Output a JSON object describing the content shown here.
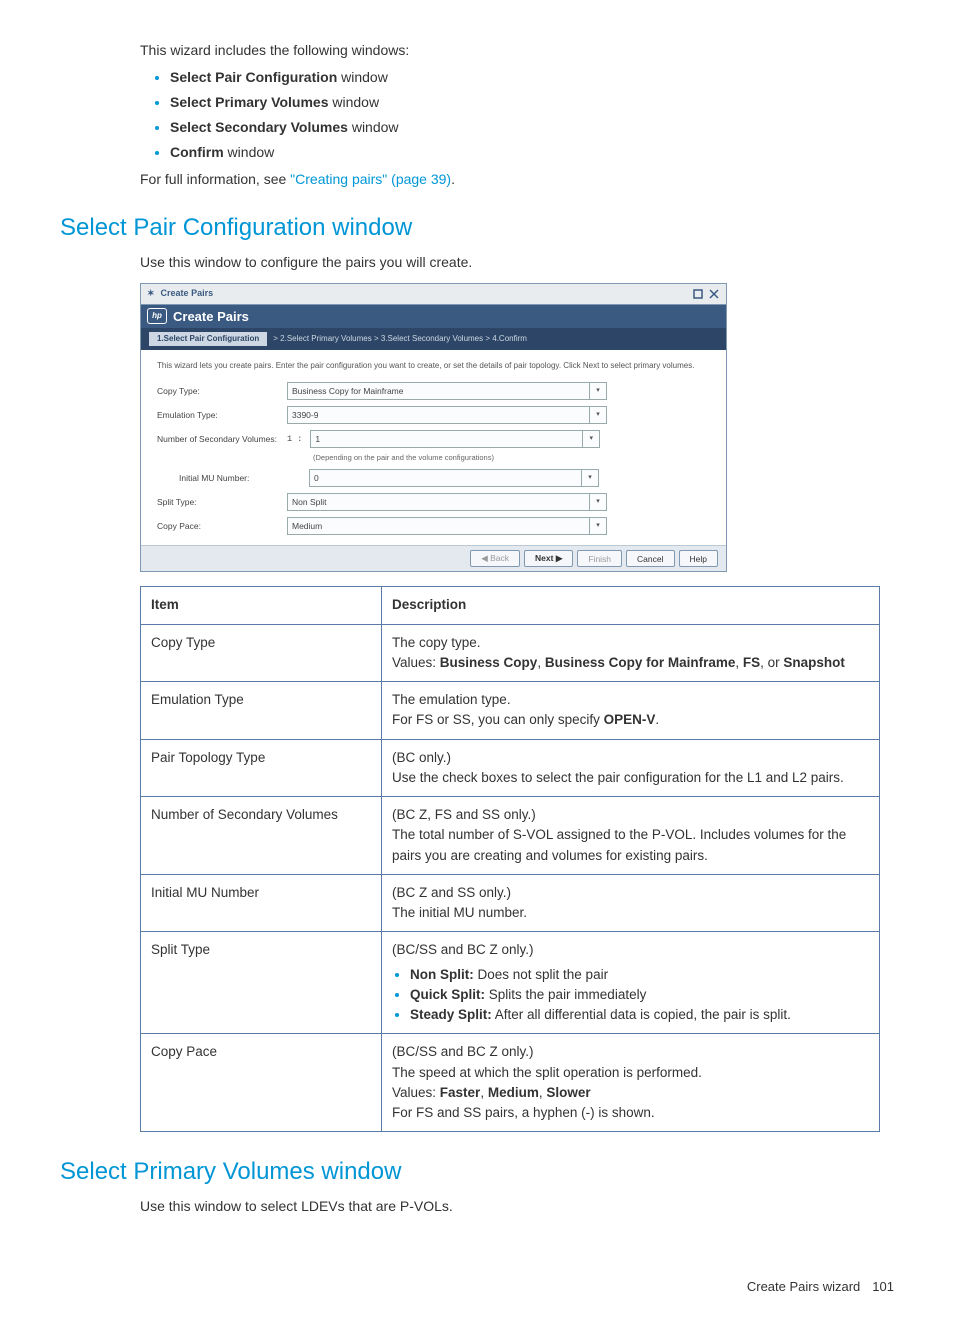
{
  "intro": {
    "line1": "This wizard includes the following windows:",
    "bullets": [
      {
        "bold": "Select Pair Configuration",
        "rest": " window"
      },
      {
        "bold": "Select Primary Volumes",
        "rest": " window"
      },
      {
        "bold": "Select Secondary Volumes",
        "rest": " window"
      },
      {
        "bold": "Confirm",
        "rest": " window"
      }
    ],
    "full_info_pre": "For full information, see ",
    "full_info_link": "\"Creating pairs\" (page 39)",
    "full_info_post": "."
  },
  "section1": {
    "heading": "Select Pair Configuration window",
    "desc": "Use this window to configure the pairs you will create."
  },
  "wizard": {
    "title": "Create Pairs",
    "brand": "Create Pairs",
    "steps": {
      "active": "1.Select Pair Configuration",
      "trail_a": ">  2.Select Primary Volumes  >  3.Select Secondary Volumes  >  4.Confirm"
    },
    "desc": "This wizard lets you create pairs. Enter the pair configuration you want to create, or set the details of pair topology. Click Next to select primary volumes.",
    "fields": {
      "copy_type": {
        "label": "Copy Type:",
        "value": "Business Copy for Mainframe"
      },
      "emulation_type": {
        "label": "Emulation Type:",
        "value": "3390-9"
      },
      "num_sec": {
        "label": "Number of Secondary Volumes:",
        "prefix": "1 :",
        "value": "1",
        "hint": "(Depending on the pair and the volume configurations)"
      },
      "initial_mu": {
        "label": "Initial MU Number:",
        "value": "0"
      },
      "split_type": {
        "label": "Split Type:",
        "value": "Non Split"
      },
      "copy_pace": {
        "label": "Copy Pace:",
        "value": "Medium"
      }
    },
    "buttons": {
      "back": "◀ Back",
      "next": "Next ▶",
      "finish": "Finish",
      "cancel": "Cancel",
      "help": "Help"
    }
  },
  "table": {
    "headers": {
      "item": "Item",
      "desc": "Description"
    },
    "rows": {
      "copy_type": {
        "item": "Copy Type",
        "p1": "The copy type.",
        "p2_pre": "Values: ",
        "p2_b1": "Business Copy",
        "p2_m1": ", ",
        "p2_b2": "Business Copy for Mainframe",
        "p2_m2": ", ",
        "p2_b3": "FS",
        "p2_m3": ", or ",
        "p2_b4": "Snapshot"
      },
      "emulation_type": {
        "item": "Emulation Type",
        "p1": "The emulation type.",
        "p2_pre": "For FS or SS, you can only specify ",
        "p2_b": "OPEN-V",
        "p2_post": "."
      },
      "pair_topology": {
        "item": "Pair Topology Type",
        "p1": "(BC only.)",
        "p2": "Use the check boxes to select the pair configuration for the L1 and L2 pairs."
      },
      "num_sec": {
        "item": "Number of Secondary Volumes",
        "p1": "(BC Z, FS and SS only.)",
        "p2": "The total number of S-VOL assigned to the P-VOL. Includes volumes for the pairs you are creating and volumes for existing pairs."
      },
      "initial_mu": {
        "item": "Initial MU Number",
        "p1": "(BC Z and SS only.)",
        "p2": "The initial MU number."
      },
      "split_type": {
        "item": "Split Type",
        "p1": "(BC/SS and BC Z only.)",
        "li1_b": "Non Split:",
        "li1_r": " Does not split the pair",
        "li2_b": "Quick Split:",
        "li2_r": " Splits the pair immediately",
        "li3_b": "Steady Split:",
        "li3_r": " After all differential data is copied, the pair is split."
      },
      "copy_pace": {
        "item": "Copy Pace",
        "p1": "(BC/SS and BC Z only.)",
        "p2": "The speed at which the split operation is performed.",
        "p3_pre": "Values: ",
        "p3_b1": "Faster",
        "p3_m1": ", ",
        "p3_b2": "Medium",
        "p3_m2": ", ",
        "p3_b3": "Slower",
        "p4": "For FS and SS pairs, a hyphen (-) is shown."
      }
    }
  },
  "section2": {
    "heading": "Select Primary Volumes window",
    "desc": "Use this window to select LDEVs that are P-VOLs."
  },
  "footer": {
    "text": "Create Pairs wizard",
    "page": "101"
  }
}
